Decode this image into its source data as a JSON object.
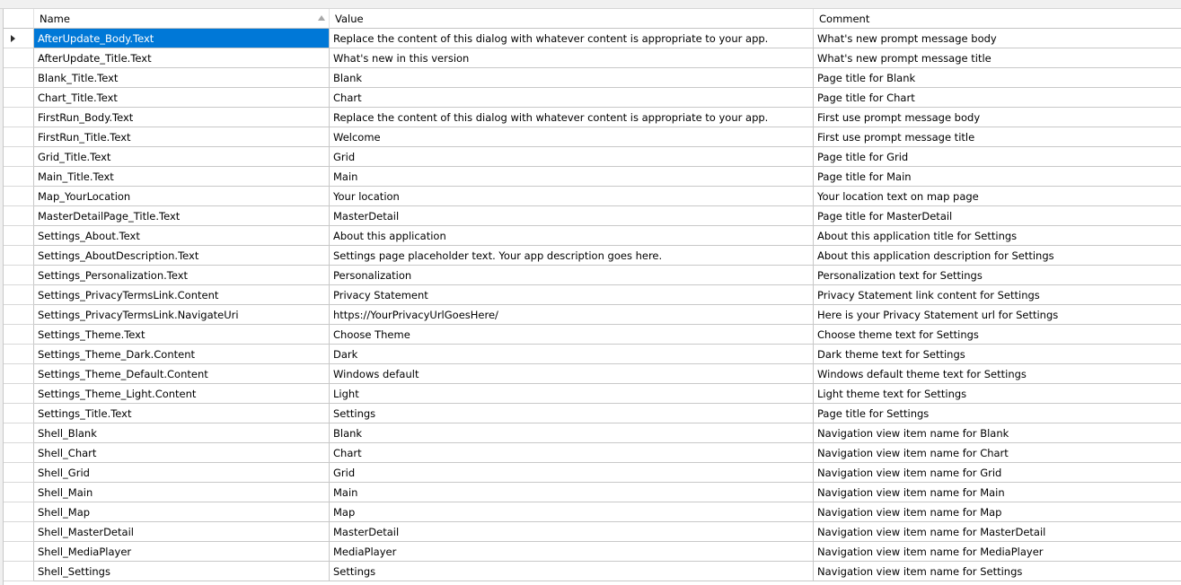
{
  "columns": {
    "name": "Name",
    "value": "Value",
    "comment": "Comment"
  },
  "rows": [
    {
      "name": "AfterUpdate_Body.Text",
      "value": "Replace the content of this dialog with whatever content is appropriate to your app.",
      "comment": "What's new prompt message body"
    },
    {
      "name": "AfterUpdate_Title.Text",
      "value": "What's new in this version",
      "comment": "What's new prompt message title"
    },
    {
      "name": "Blank_Title.Text",
      "value": "Blank",
      "comment": "Page title for Blank"
    },
    {
      "name": "Chart_Title.Text",
      "value": "Chart",
      "comment": "Page title for Chart"
    },
    {
      "name": "FirstRun_Body.Text",
      "value": "Replace the content of this dialog with whatever content is appropriate to your app.",
      "comment": "First use prompt message body"
    },
    {
      "name": "FirstRun_Title.Text",
      "value": "Welcome",
      "comment": "First use prompt message title"
    },
    {
      "name": "Grid_Title.Text",
      "value": "Grid",
      "comment": "Page title for Grid"
    },
    {
      "name": "Main_Title.Text",
      "value": "Main",
      "comment": "Page title for Main"
    },
    {
      "name": "Map_YourLocation",
      "value": "Your location",
      "comment": "Your location text on map page"
    },
    {
      "name": "MasterDetailPage_Title.Text",
      "value": "MasterDetail",
      "comment": "Page title for MasterDetail"
    },
    {
      "name": "Settings_About.Text",
      "value": "About this application",
      "comment": "About this application title for Settings"
    },
    {
      "name": "Settings_AboutDescription.Text",
      "value": "Settings page placeholder text.  Your app description goes here.",
      "comment": "About this application description for Settings"
    },
    {
      "name": "Settings_Personalization.Text",
      "value": "Personalization",
      "comment": "Personalization text for Settings"
    },
    {
      "name": "Settings_PrivacyTermsLink.Content",
      "value": "Privacy Statement",
      "comment": "Privacy Statement link content for Settings"
    },
    {
      "name": "Settings_PrivacyTermsLink.NavigateUri",
      "value": "https://YourPrivacyUrlGoesHere/",
      "comment": "Here is your Privacy Statement url for Settings"
    },
    {
      "name": "Settings_Theme.Text",
      "value": "Choose Theme",
      "comment": "Choose theme text for Settings"
    },
    {
      "name": "Settings_Theme_Dark.Content",
      "value": "Dark",
      "comment": "Dark theme text for Settings"
    },
    {
      "name": "Settings_Theme_Default.Content",
      "value": "Windows default",
      "comment": "Windows default theme text for Settings"
    },
    {
      "name": "Settings_Theme_Light.Content",
      "value": "Light",
      "comment": "Light theme text for Settings"
    },
    {
      "name": "Settings_Title.Text",
      "value": "Settings",
      "comment": "Page title for Settings"
    },
    {
      "name": "Shell_Blank",
      "value": "Blank",
      "comment": "Navigation view item name for Blank"
    },
    {
      "name": "Shell_Chart",
      "value": "Chart",
      "comment": "Navigation view item name for Chart"
    },
    {
      "name": "Shell_Grid",
      "value": "Grid",
      "comment": "Navigation view item name for Grid"
    },
    {
      "name": "Shell_Main",
      "value": "Main",
      "comment": "Navigation view item name for Main"
    },
    {
      "name": "Shell_Map",
      "value": "Map",
      "comment": "Navigation view item name for Map"
    },
    {
      "name": "Shell_MasterDetail",
      "value": "MasterDetail",
      "comment": "Navigation view item name for MasterDetail"
    },
    {
      "name": "Shell_MediaPlayer",
      "value": "MediaPlayer",
      "comment": "Navigation view item name for MediaPlayer"
    },
    {
      "name": "Shell_Settings",
      "value": "Settings",
      "comment": "Navigation view item name for Settings"
    }
  ],
  "selected_row": 0,
  "colors": {
    "selection": "#0078d7",
    "grid_line": "#c8c8c8"
  }
}
